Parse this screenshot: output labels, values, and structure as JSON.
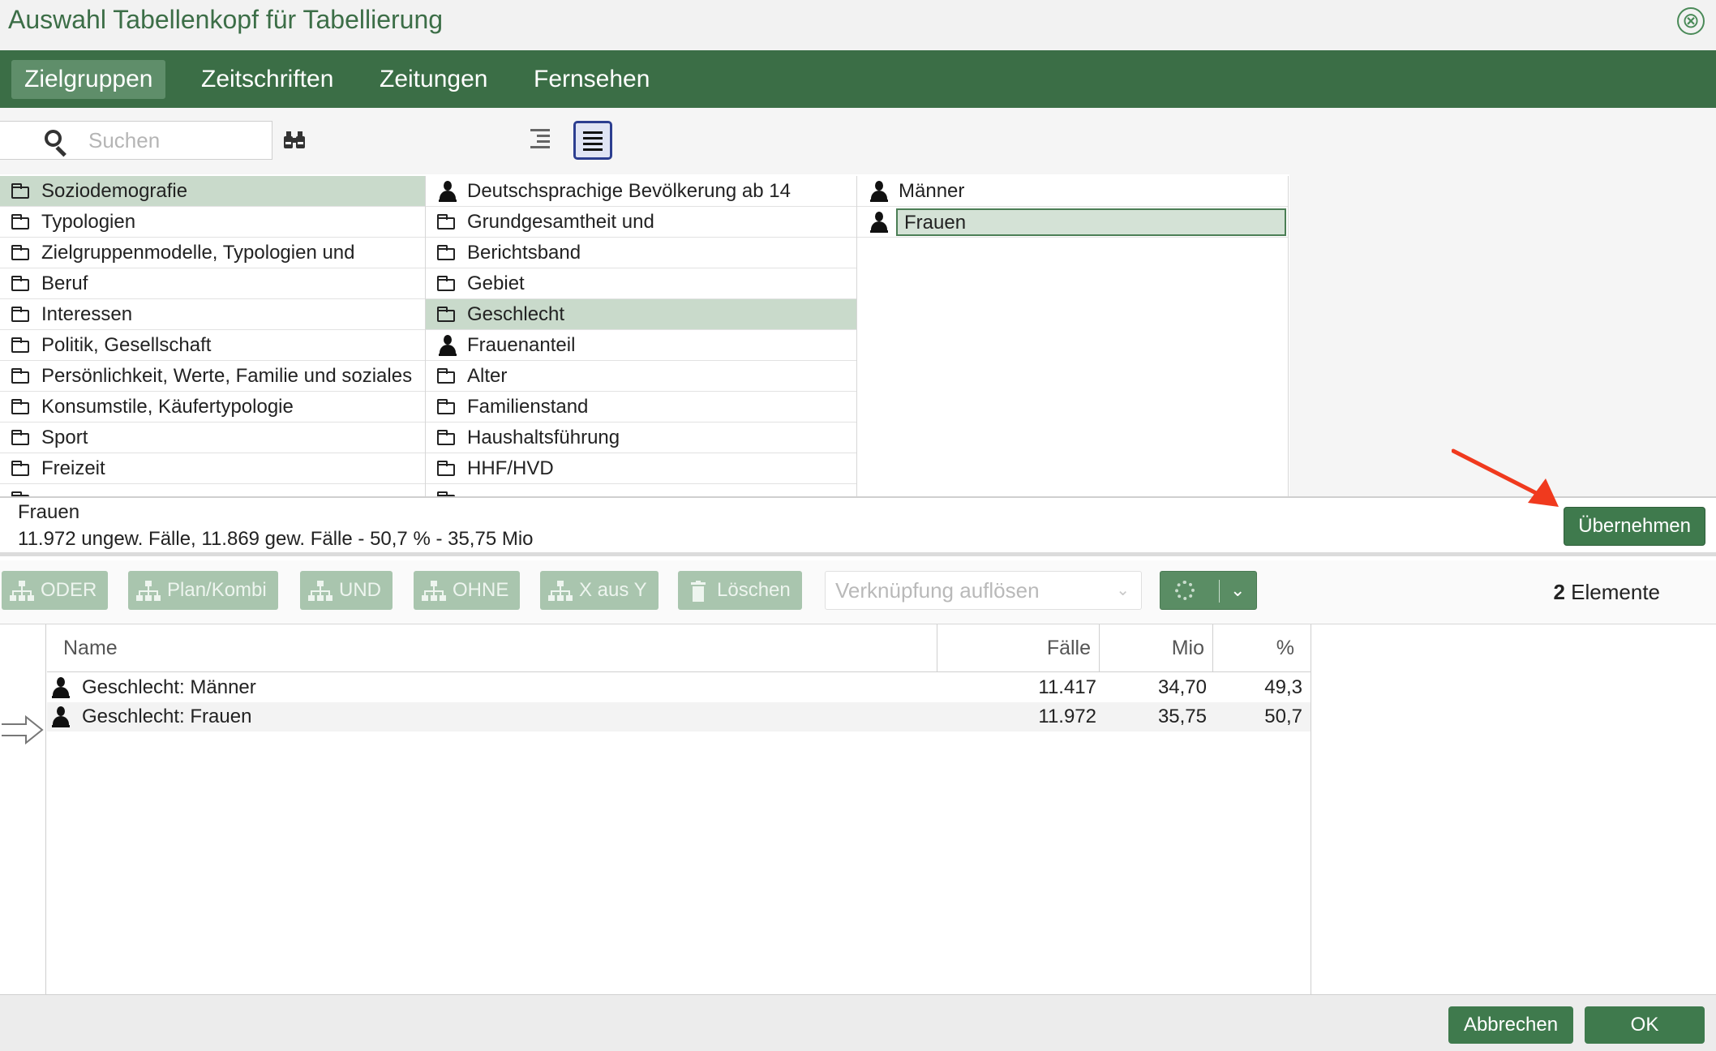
{
  "window": {
    "title": "Auswahl Tabellenkopf für Tabellierung",
    "close_glyph": "⊗"
  },
  "tabs": [
    {
      "label": "Zielgruppen",
      "active": true
    },
    {
      "label": "Zeitschriften",
      "active": false
    },
    {
      "label": "Zeitungen",
      "active": false
    },
    {
      "label": "Fernsehen",
      "active": false
    }
  ],
  "toolbar": {
    "search_placeholder": "Suchen",
    "binoculars_icon": "binoculars-icon",
    "view_buttons": [
      "indent-view-icon",
      "list-view-icon"
    ],
    "active_view": "list-view-icon"
  },
  "column1": [
    {
      "icon": "folder",
      "label": "Soziodemografie",
      "selected": true
    },
    {
      "icon": "folder",
      "label": "Typologien"
    },
    {
      "icon": "folder",
      "label": "Zielgruppenmodelle, Typologien und"
    },
    {
      "icon": "folder",
      "label": "Beruf"
    },
    {
      "icon": "folder",
      "label": "Interessen"
    },
    {
      "icon": "folder",
      "label": "Politik, Gesellschaft"
    },
    {
      "icon": "folder",
      "label": "Persönlichkeit, Werte, Familie und soziales"
    },
    {
      "icon": "folder",
      "label": "Konsumstile, Käufertypologie"
    },
    {
      "icon": "folder",
      "label": "Sport"
    },
    {
      "icon": "folder",
      "label": "Freizeit"
    }
  ],
  "column2": [
    {
      "icon": "person",
      "label": "Deutschsprachige Bevölkerung ab 14"
    },
    {
      "icon": "folder",
      "label": "Grundgesamtheit und"
    },
    {
      "icon": "folder",
      "label": "Berichtsband"
    },
    {
      "icon": "folder",
      "label": "Gebiet"
    },
    {
      "icon": "folder",
      "label": "Geschlecht",
      "selected": true
    },
    {
      "icon": "person",
      "label": "Frauenanteil"
    },
    {
      "icon": "folder",
      "label": "Alter"
    },
    {
      "icon": "folder",
      "label": "Familienstand"
    },
    {
      "icon": "folder",
      "label": "Haushaltsführung"
    },
    {
      "icon": "folder",
      "label": "HHF/HVD"
    }
  ],
  "column3": [
    {
      "icon": "person",
      "label": "Männer"
    },
    {
      "icon": "person",
      "label": "Frauen",
      "selected": true
    }
  ],
  "info": {
    "name": "Frauen",
    "stats": "11.972 ungew. Fälle, 11.869 gew. Fälle - 50,7 % - 35,75 Mio",
    "apply_label": "Übernehmen"
  },
  "operations": {
    "buttons": [
      "ODER",
      "Plan/Kombi",
      "UND",
      "OHNE",
      "X aus Y",
      "Löschen"
    ],
    "select_placeholder": "Verknüpfung auflösen",
    "count_number": "2",
    "count_label": "Elemente"
  },
  "table": {
    "headers": [
      "Name",
      "Fälle",
      "Mio",
      "%"
    ],
    "rows": [
      {
        "name": "Geschlecht: Männer",
        "faelle": "11.417",
        "mio": "34,70",
        "pct": "49,3"
      },
      {
        "name": "Geschlecht: Frauen",
        "faelle": "11.972",
        "mio": "35,75",
        "pct": "50,7",
        "current": true
      }
    ]
  },
  "footer": {
    "cancel_label": "Abbrechen",
    "ok_label": "OK"
  },
  "colors": {
    "brand_green": "#3b6e46",
    "selection_green": "#c9dacb",
    "annotation_red": "#f03a1e"
  }
}
